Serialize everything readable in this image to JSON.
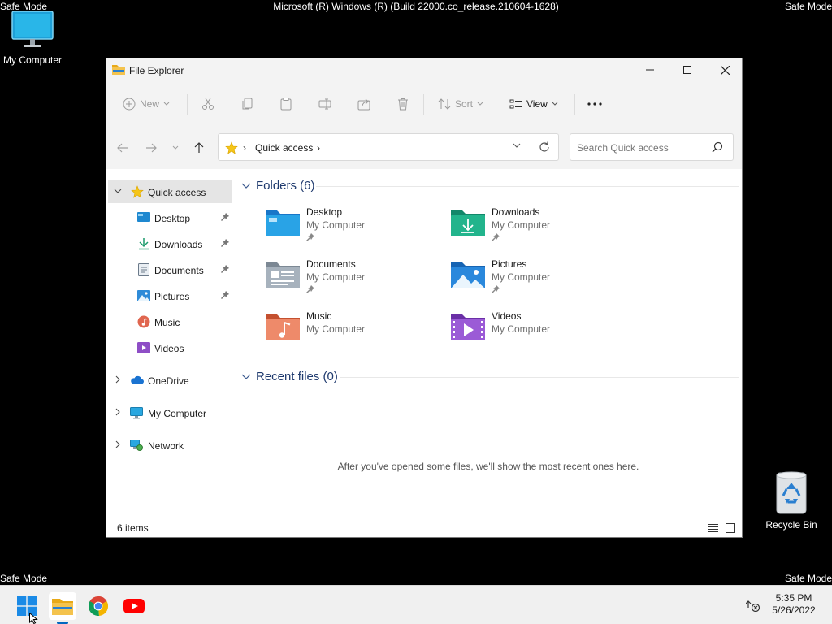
{
  "overlay": {
    "safe_mode": "Safe Mode",
    "build": "Microsoft (R) Windows (R) (Build 22000.co_release.210604-1628)"
  },
  "desktop": {
    "my_computer": "My Computer",
    "recycle_bin": "Recycle Bin"
  },
  "window": {
    "title": "File Explorer",
    "toolbar": {
      "new_label": "New",
      "sort_label": "Sort",
      "view_label": "View"
    },
    "address": {
      "location": "Quick access",
      "search_placeholder": "Search Quick access"
    },
    "sidebar": {
      "quick_access": "Quick access",
      "pinned": [
        {
          "label": "Desktop",
          "icon": "desktop-icon",
          "pinned": true
        },
        {
          "label": "Downloads",
          "icon": "downloads-icon",
          "pinned": true
        },
        {
          "label": "Documents",
          "icon": "documents-icon",
          "pinned": true
        },
        {
          "label": "Pictures",
          "icon": "pictures-icon",
          "pinned": true
        },
        {
          "label": "Music",
          "icon": "music-icon",
          "pinned": false
        },
        {
          "label": "Videos",
          "icon": "videos-icon",
          "pinned": false
        }
      ],
      "onedrive": "OneDrive",
      "my_computer": "My Computer",
      "network": "Network"
    },
    "folders_header": "Folders (6)",
    "folders": [
      {
        "name": "Desktop",
        "location": "My Computer",
        "pinned": true
      },
      {
        "name": "Downloads",
        "location": "My Computer",
        "pinned": true
      },
      {
        "name": "Documents",
        "location": "My Computer",
        "pinned": true
      },
      {
        "name": "Pictures",
        "location": "My Computer",
        "pinned": true
      },
      {
        "name": "Music",
        "location": "My Computer",
        "pinned": false
      },
      {
        "name": "Videos",
        "location": "My Computer",
        "pinned": false
      }
    ],
    "recent_header": "Recent files (0)",
    "recent_empty": "After you've opened some files, we'll show the most recent ones here.",
    "status": "6 items"
  },
  "taskbar": {
    "time": "5:35 PM",
    "date": "5/26/2022"
  },
  "colors": {
    "accent": "#0067c0",
    "folder_yellow": "#f4c34d",
    "section_header": "#1f3a6e"
  }
}
